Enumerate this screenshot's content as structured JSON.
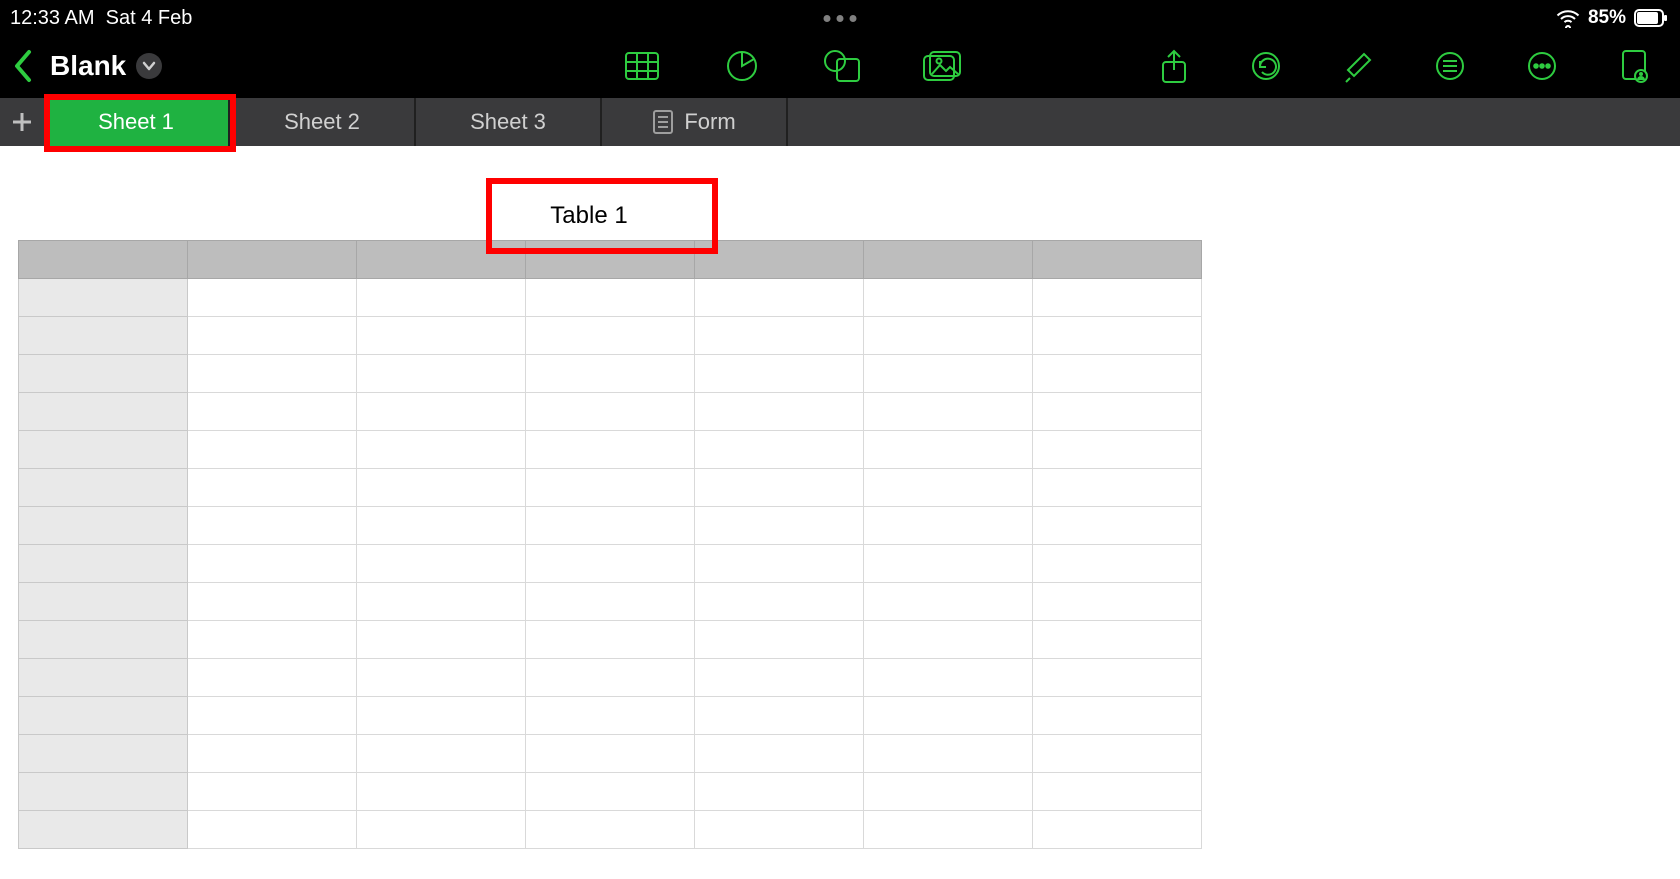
{
  "status": {
    "time": "12:33 AM",
    "date": "Sat 4 Feb",
    "battery": "85%"
  },
  "nav": {
    "title": "Blank"
  },
  "tabs": {
    "sheet1": "Sheet 1",
    "sheet2": "Sheet 2",
    "sheet3": "Sheet 3",
    "form": "Form"
  },
  "table": {
    "title": "Table 1",
    "columns": 7,
    "rows": 15
  }
}
